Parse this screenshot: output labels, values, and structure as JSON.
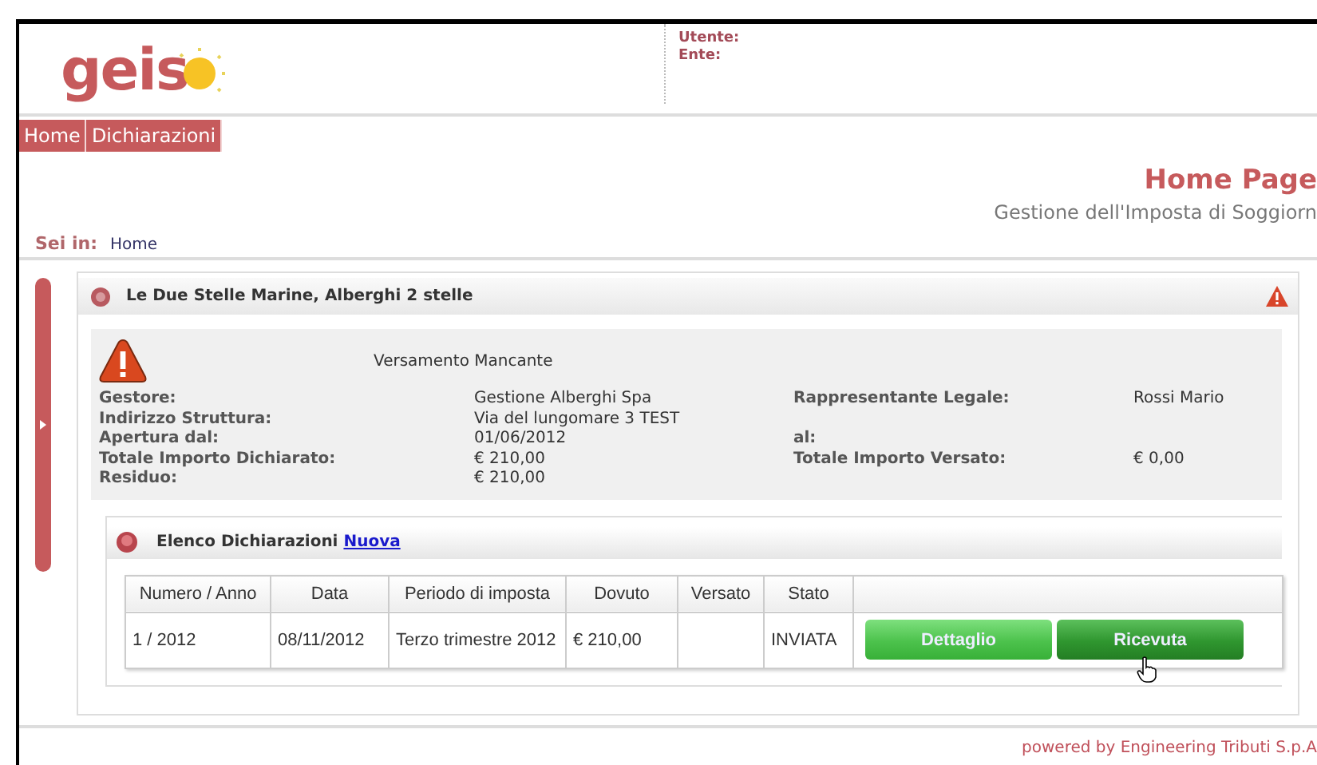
{
  "logo": {
    "text": "geis"
  },
  "user_info": [
    "Utente:",
    "Ente:"
  ],
  "nav": [
    "Home",
    "Dichiarazioni"
  ],
  "page": {
    "title": "Home Page",
    "subtitle": "Gestione dell'Imposta di Soggiorn"
  },
  "breadcrumb": {
    "label": "Sei in:",
    "items": [
      "Home"
    ]
  },
  "structure": {
    "title": "Le Due Stelle Marine, Alberghi 2 stelle",
    "alert": "Versamento Mancante",
    "rows": [
      {
        "label": "Gestore:",
        "value": "Gestione Alberghi Spa",
        "label_2": "Rappresentante Legale:",
        "value_2": "Rossi Mario"
      },
      {
        "label": "Indirizzo Struttura:",
        "value": "Via del lungomare 3 TEST"
      },
      {
        "label": "Apertura dal:",
        "value": "01/06/2012",
        "label_2": "al:"
      },
      {
        "label": "Totale Importo Dichiarato:",
        "value": "€ 210,00",
        "label_2": "Totale Importo Versato:",
        "value_2": "€ 0,00"
      },
      {
        "label": "Residuo:",
        "value": "€ 210,00"
      }
    ]
  },
  "declarations": {
    "title": "Elenco Dichiarazioni",
    "link": "Nuova",
    "columns": [
      "Numero / Anno",
      "Data",
      "Periodo di imposta",
      "Dovuto",
      "Versato",
      "Stato"
    ],
    "rows": [
      {
        "numero": "1 / 2012",
        "data": "08/11/2012",
        "periodo": "Terzo trimestre 2012",
        "dovuto": "€ 210,00",
        "stato": "INVIATA",
        "buttons": [
          {
            "label": "Dettaglio",
            "hovered": false
          },
          {
            "label": "Ricevuta",
            "hovered": true
          }
        ]
      }
    ]
  },
  "footer": "powered by Engineering Tributi S.p.A"
}
